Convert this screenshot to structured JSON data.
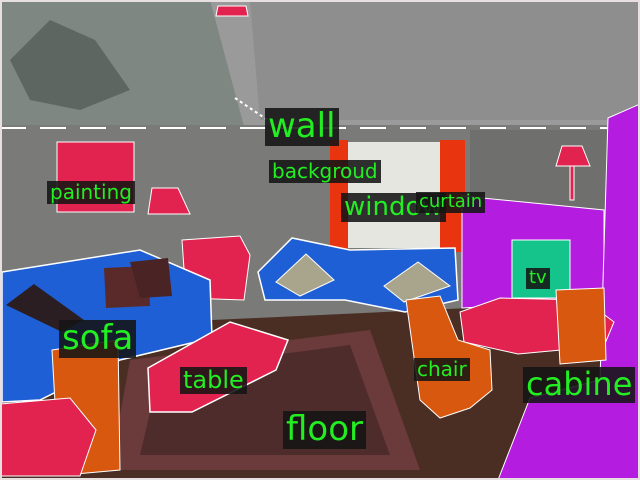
{
  "labels": {
    "wall": "wall",
    "backgroud": "backgroud",
    "painting": "painting",
    "window": "window",
    "curtain": "curtain",
    "tv": "tv",
    "sofa": "sofa",
    "chair": "chair",
    "table": "table",
    "cabinet": "cabine",
    "floor": "floor"
  },
  "colors": {
    "wall": "#8c8c8c",
    "sofa": "#1f5fd6",
    "table": "#e2234f",
    "chair": "#d9580f",
    "cabinet": "#b41ce0",
    "tv": "#15c48a",
    "curtain": "#e8340f",
    "painting": "#e2234f",
    "floor": "#4a2e24",
    "rug": "#6b3a3a",
    "label_text": "#22ee22",
    "label_bg": "#141414",
    "outline": "#ffffff"
  }
}
